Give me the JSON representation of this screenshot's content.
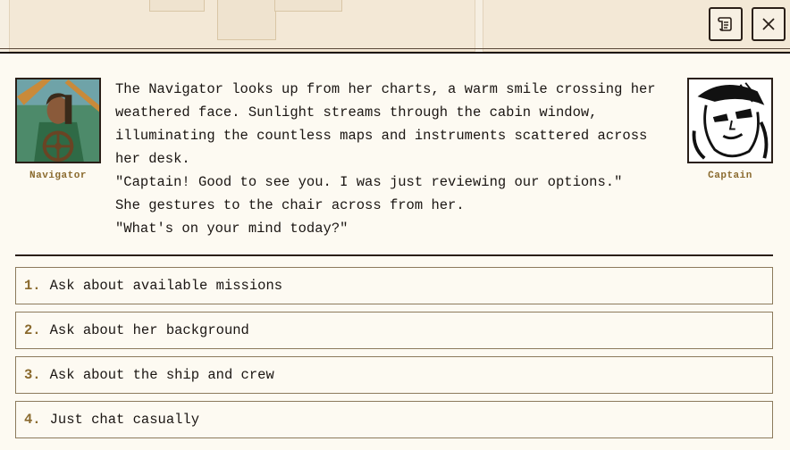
{
  "toolbar": {
    "log_button_icon": "scroll-icon",
    "close_button_icon": "close-icon"
  },
  "speaker_left": {
    "name": "Navigator"
  },
  "speaker_right": {
    "name": "Captain"
  },
  "dialog": {
    "lines": [
      "The Navigator looks up from her charts, a warm smile crossing her\nweathered face. Sunlight streams through the cabin window,\nilluminating the countless maps and instruments scattered across\nher desk.",
      "\"Captain! Good to see you. I was just reviewing our options.\"",
      "She gestures to the chair across from her.",
      "\"What's on your mind today?\""
    ]
  },
  "choices": [
    {
      "num": "1.",
      "label": "Ask about available missions"
    },
    {
      "num": "2.",
      "label": "Ask about her background"
    },
    {
      "num": "3.",
      "label": "Ask about the ship and crew"
    },
    {
      "num": "4.",
      "label": "Just chat casually"
    }
  ],
  "colors": {
    "accent": "#8a6a2e",
    "border": "#2a1f18",
    "background": "#fdfaf2"
  }
}
